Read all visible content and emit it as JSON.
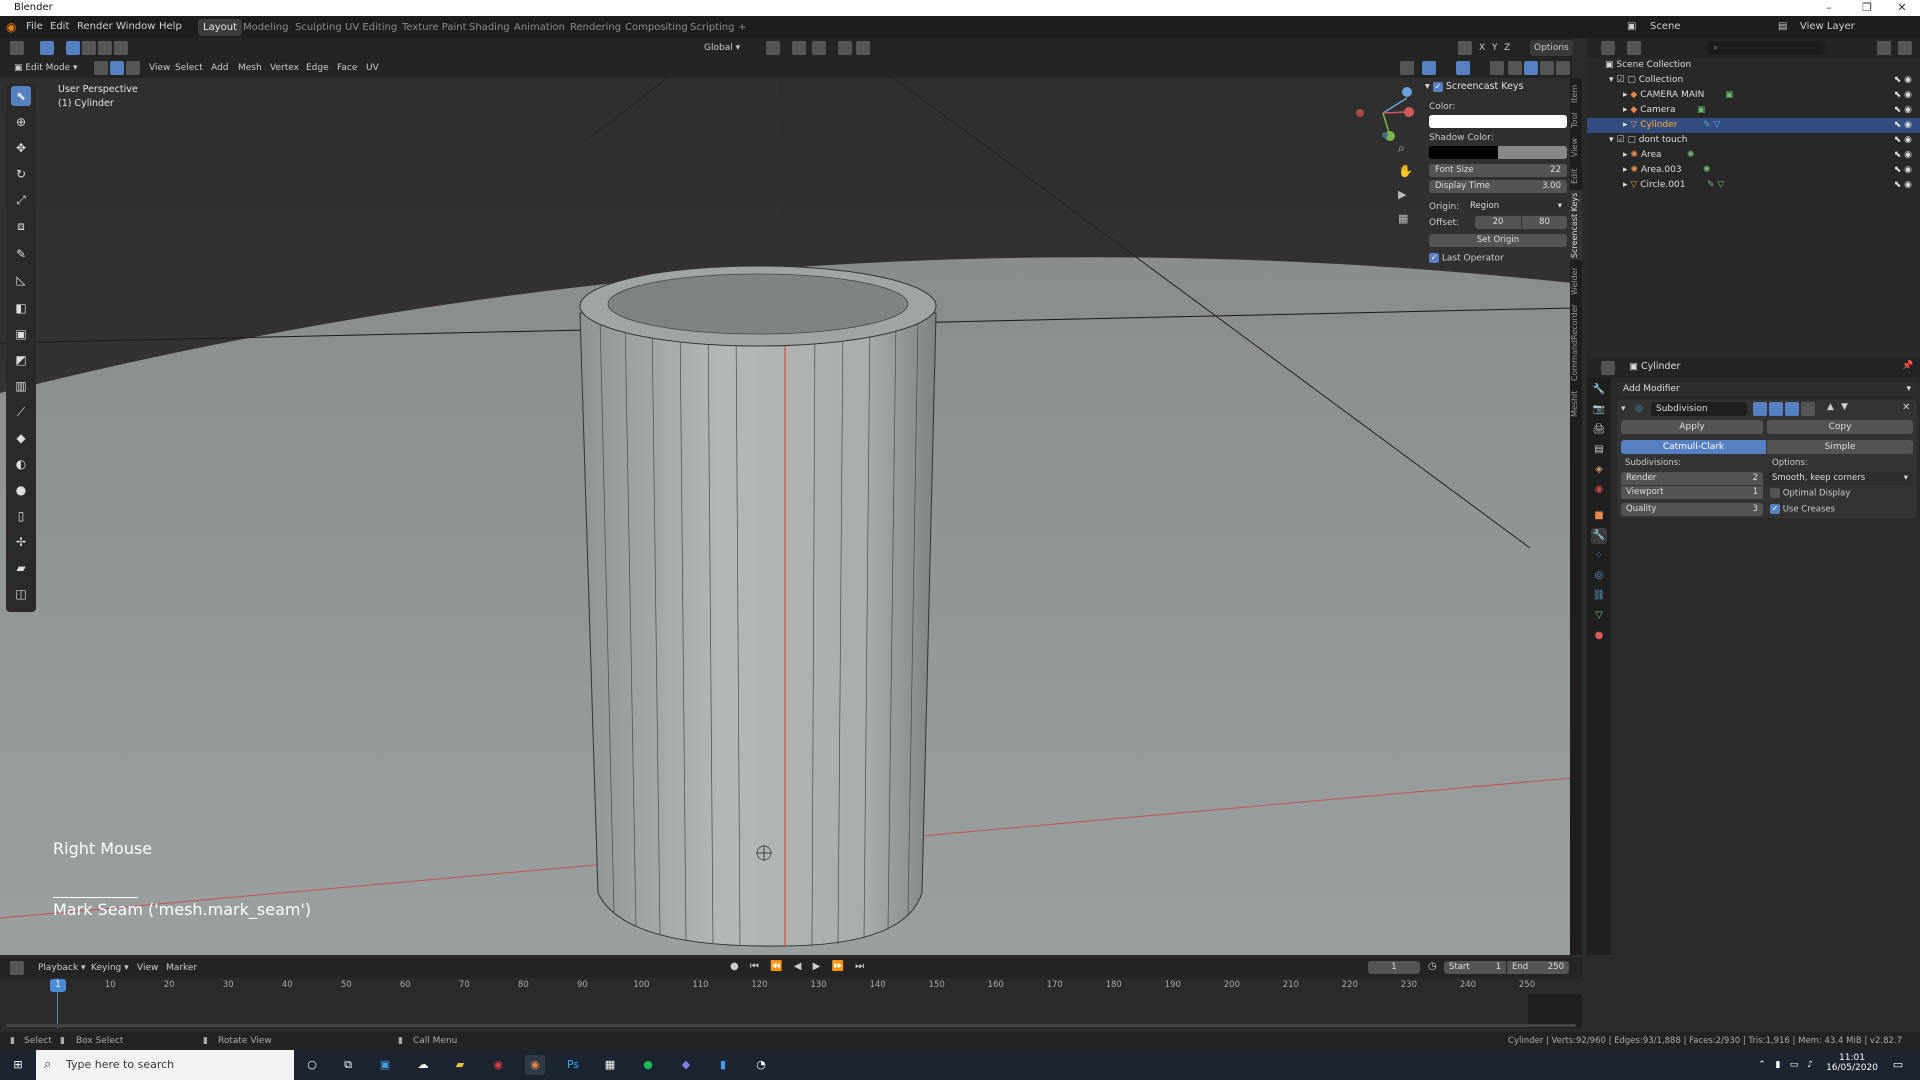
{
  "window": {
    "title": "Blender"
  },
  "menubar": {
    "menus": [
      "File",
      "Edit",
      "Render",
      "Window",
      "Help"
    ],
    "workspaces": [
      "Layout",
      "Modeling",
      "Sculpting",
      "UV Editing",
      "Texture Paint",
      "Shading",
      "Animation",
      "Rendering",
      "Compositing",
      "Scripting"
    ],
    "active_workspace": "Layout",
    "add_tab": "+",
    "scene_label": "Scene",
    "view_layer_label": "View Layer"
  },
  "viewport_header": {
    "mode": "Edit Mode",
    "menus": [
      "View",
      "Select",
      "Add",
      "Mesh",
      "Vertex",
      "Edge",
      "Face",
      "UV"
    ],
    "transform_orientation": "Global",
    "axes": [
      "X",
      "Y",
      "Z"
    ],
    "options_label": "Options"
  },
  "viewport": {
    "view_name": "User Perspective",
    "object_name": "(1) Cylinder",
    "key_display": "Right Mouse",
    "last_operator_display": "Mark Seam ('mesh.mark_seam')"
  },
  "screencast_panel": {
    "title": "Screencast Keys",
    "color_label": "Color:",
    "shadow_color_label": "Shadow Color:",
    "font_size_label": "Font Size",
    "font_size_value": "22",
    "display_time_label": "Display Time",
    "display_time_value": "3.00",
    "origin_label": "Origin:",
    "origin_value": "Region",
    "offset_label": "Offset:",
    "offset_x": "20",
    "offset_y": "80",
    "set_origin_label": "Set Origin",
    "last_operator_label": "Last Operator",
    "colors": {
      "main": "#ffffff",
      "shadow": "#000000"
    }
  },
  "side_tabs": [
    "Item",
    "Tool",
    "View",
    "Edit",
    "Screencast Keys",
    "Welder",
    "CommandRecorder",
    "MeshIt"
  ],
  "outliner": {
    "root": "Scene Collection",
    "rows": [
      {
        "label": "Collection",
        "depth": 1,
        "selected": false
      },
      {
        "label": "CAMERA MAIN",
        "depth": 2,
        "selected": false
      },
      {
        "label": "Camera",
        "depth": 2,
        "selected": false
      },
      {
        "label": "Cylinder",
        "depth": 2,
        "selected": true
      },
      {
        "label": "dont touch",
        "depth": 1,
        "selected": false
      },
      {
        "label": "Area",
        "depth": 2,
        "selected": false
      },
      {
        "label": "Area.003",
        "depth": 2,
        "selected": false
      },
      {
        "label": "Circle.001",
        "depth": 2,
        "selected": false
      }
    ]
  },
  "properties": {
    "object_name": "Cylinder",
    "add_modifier_label": "Add Modifier",
    "modifier_name": "Subdivision",
    "apply_label": "Apply",
    "copy_label": "Copy",
    "catmull_label": "Catmull-Clark",
    "simple_label": "Simple",
    "subdivisions_label": "Subdivisions:",
    "options_label": "Options:",
    "render_label": "Render",
    "render_value": "2",
    "viewport_label": "Viewport",
    "viewport_value": "1",
    "quality_label": "Quality",
    "quality_value": "3",
    "uv_smooth_value": "Smooth, keep corners",
    "optimal_display_label": "Optimal Display",
    "use_creases_label": "Use Creases",
    "optimal_display_checked": false,
    "use_creases_checked": true
  },
  "timeline": {
    "menus": [
      "Playback",
      "Keying",
      "View",
      "Marker"
    ],
    "current_frame": "1",
    "start_label": "Start",
    "start_value": "1",
    "end_label": "End",
    "end_value": "250",
    "ticks": [
      "1",
      "10",
      "20",
      "30",
      "40",
      "50",
      "60",
      "70",
      "80",
      "90",
      "100",
      "110",
      "120",
      "130",
      "140",
      "150",
      "160",
      "170",
      "180",
      "190",
      "200",
      "210",
      "220",
      "230",
      "240",
      "250"
    ]
  },
  "statusbar": {
    "select_label": "Select",
    "box_select_label": "Box Select",
    "rotate_view_label": "Rotate View",
    "call_menu_label": "Call Menu",
    "stats": "Cylinder | Verts:92/960 | Edges:93/1,888 | Faces:2/930 | Tris:1,916 | Mem: 43.4 MiB | v2.82.7"
  },
  "taskbar": {
    "search_placeholder": "Type here to search",
    "time": "11:01",
    "date": "16/05/2020"
  }
}
